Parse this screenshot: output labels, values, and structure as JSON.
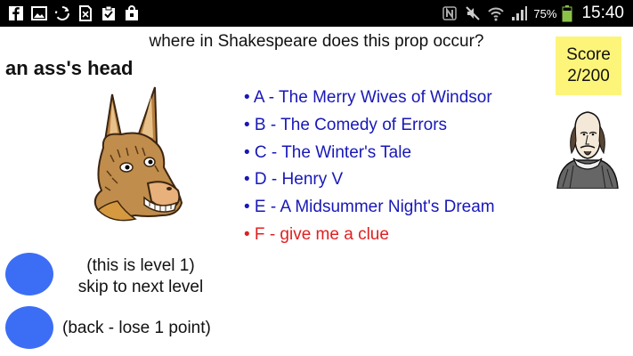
{
  "status_bar": {
    "left_icons": [
      "facebook-icon",
      "gallery-icon",
      "sync-icon",
      "file-icon",
      "clipboard-check-icon",
      "bag-icon"
    ],
    "battery_text": "75%",
    "time": "15:40"
  },
  "quiz": {
    "question": "where in Shakespeare does this prop occur?",
    "prop": "an ass's head",
    "options": [
      {
        "letter": "A",
        "text": "• A - The Merry Wives of Windsor"
      },
      {
        "letter": "B",
        "text": "• B - The Comedy of Errors"
      },
      {
        "letter": "C",
        "text": "• C - The Winter's Tale"
      },
      {
        "letter": "D",
        "text": "• D - Henry V"
      },
      {
        "letter": "E",
        "text": "• E - A Midsummer Night's Dream"
      },
      {
        "letter": "F",
        "text": "• F - give me a clue"
      }
    ]
  },
  "score": {
    "label": "Score",
    "value": "2/200"
  },
  "controls": {
    "level_text": "(this is level 1)",
    "skip_text": "skip to next level",
    "back_text": "(back - lose 1 point)"
  },
  "colors": {
    "option_blue": "#1818b8",
    "clue_red": "#e02020",
    "score_bg": "#fdf57a",
    "button_blue": "#3c6ef5"
  }
}
